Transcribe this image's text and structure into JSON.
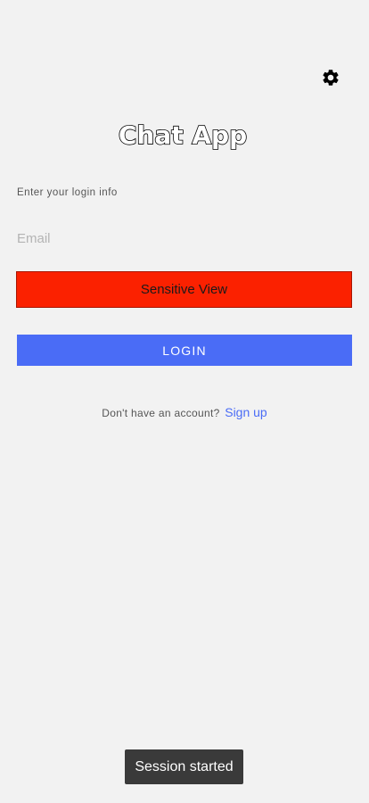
{
  "app": {
    "logo_text": "Chat App"
  },
  "header": {
    "settings_icon": "gear-icon"
  },
  "login_form": {
    "prompt": "Enter your login info",
    "email_placeholder": "Email",
    "email_value": "",
    "sensitive_view_label": "Sensitive View",
    "login_button_label": "LOGIN",
    "no_account_text": "Don't have an account?",
    "signup_link_label": "Sign up"
  },
  "toast": {
    "message": "Session started"
  },
  "colors": {
    "background": "#f2f2f2",
    "sensitive_view": "#fb2100",
    "accent": "#4a6cf6",
    "toast_background": "#3a3a3a"
  }
}
